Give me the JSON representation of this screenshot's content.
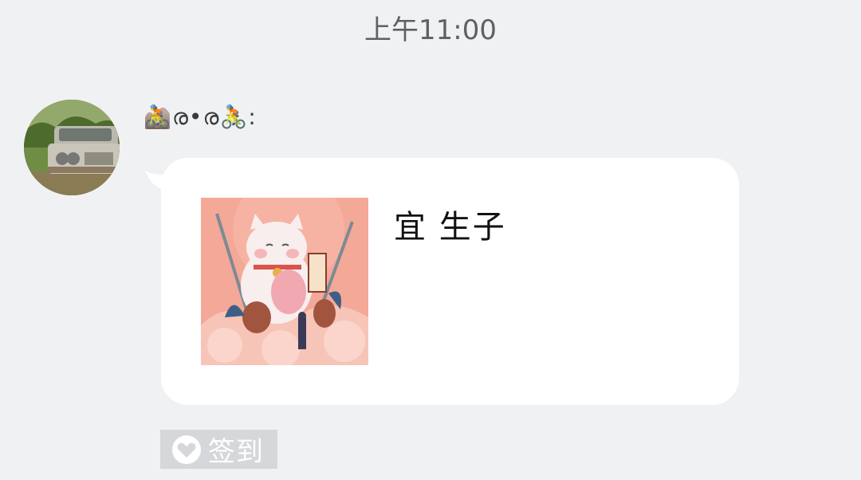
{
  "chat": {
    "timestamp": "上午11:00"
  },
  "message": {
    "sender_name": "🚵ര•ര🚴:",
    "card_text": "宜 生子",
    "card_image_icon": "lucky-cat-illustration"
  },
  "action": {
    "checkin_label": "签到",
    "checkin_icon": "heart-icon"
  },
  "colors": {
    "background": "#f0f1f3",
    "bubble": "#ffffff",
    "checkin_bg": "#d6d7da",
    "image_main": "#f3a493"
  }
}
